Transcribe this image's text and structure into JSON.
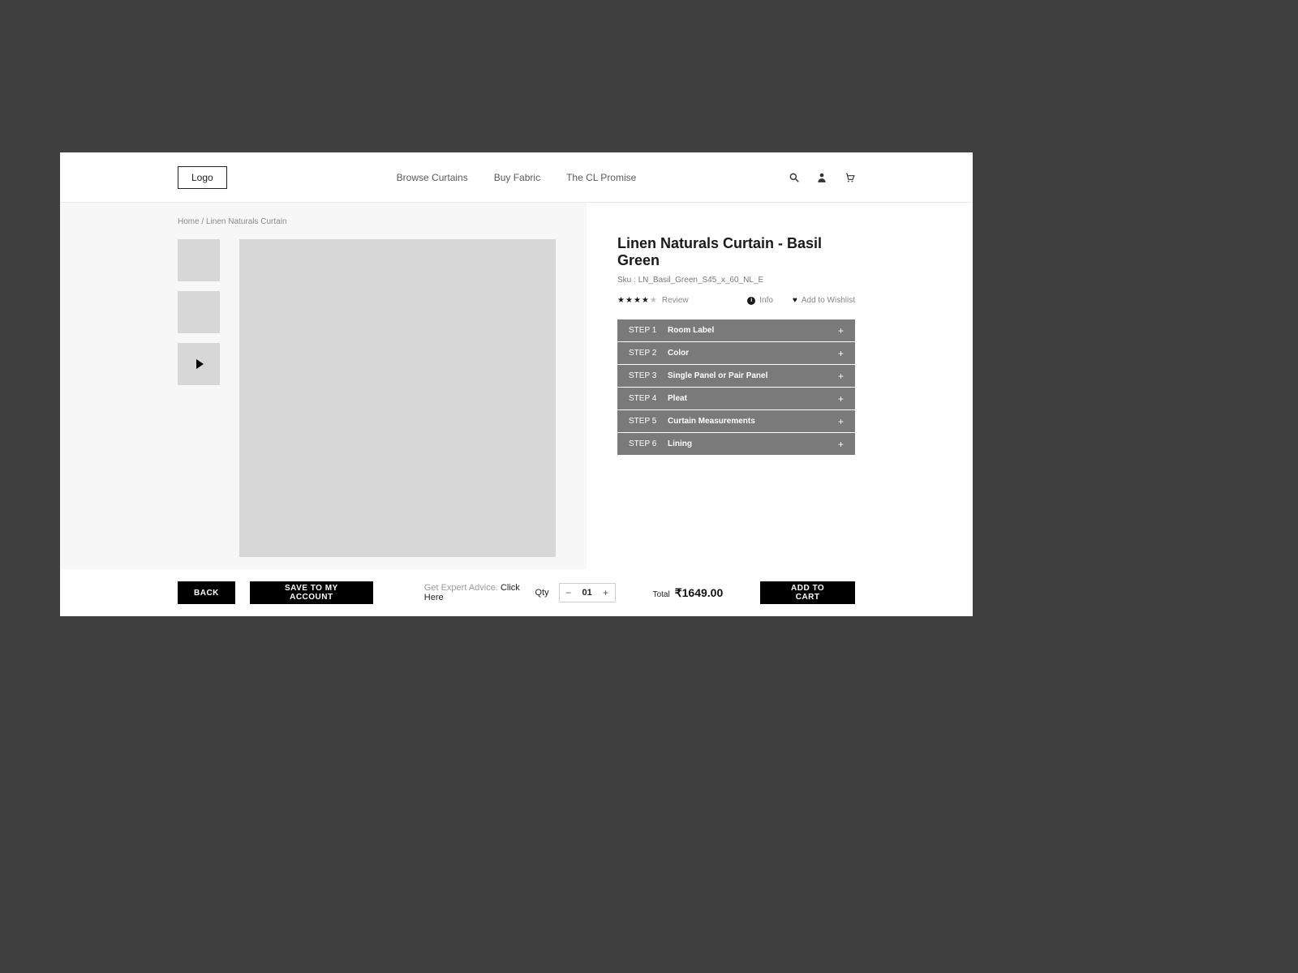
{
  "header": {
    "logo": "Logo",
    "nav": [
      "Browse Curtains",
      "Buy Fabric",
      "The CL Promise"
    ]
  },
  "breadcrumb": "Home / Linen Naturals Curtain",
  "product": {
    "title": "Linen Naturals Curtain - Basil Green",
    "sku_label": "Sku : LN_Basil_Green_S45_x_60_NL_E",
    "review_label": "Review",
    "info_label": "Info",
    "wishlist_label": "Add to Wishlist",
    "rating_full": 4,
    "rating_total": 5
  },
  "steps": [
    {
      "num": "STEP 1",
      "label": "Room Label"
    },
    {
      "num": "STEP 2",
      "label": "Color"
    },
    {
      "num": "STEP 3",
      "label": "Single Panel or Pair Panel"
    },
    {
      "num": "STEP 4",
      "label": "Pleat"
    },
    {
      "num": "STEP 5",
      "label": "Curtain Measurements"
    },
    {
      "num": "STEP 6",
      "label": "Lining"
    }
  ],
  "footer": {
    "back": "BACK",
    "save": "SAVE TO MY ACCOUNT",
    "expert_prefix": "Get Expert Advice. ",
    "expert_click": "Click Here",
    "qty_label": "Qty",
    "qty_value": "01",
    "total_label": "Total",
    "total_amount": "₹1649.00",
    "add_cart": "ADD TO CART"
  }
}
